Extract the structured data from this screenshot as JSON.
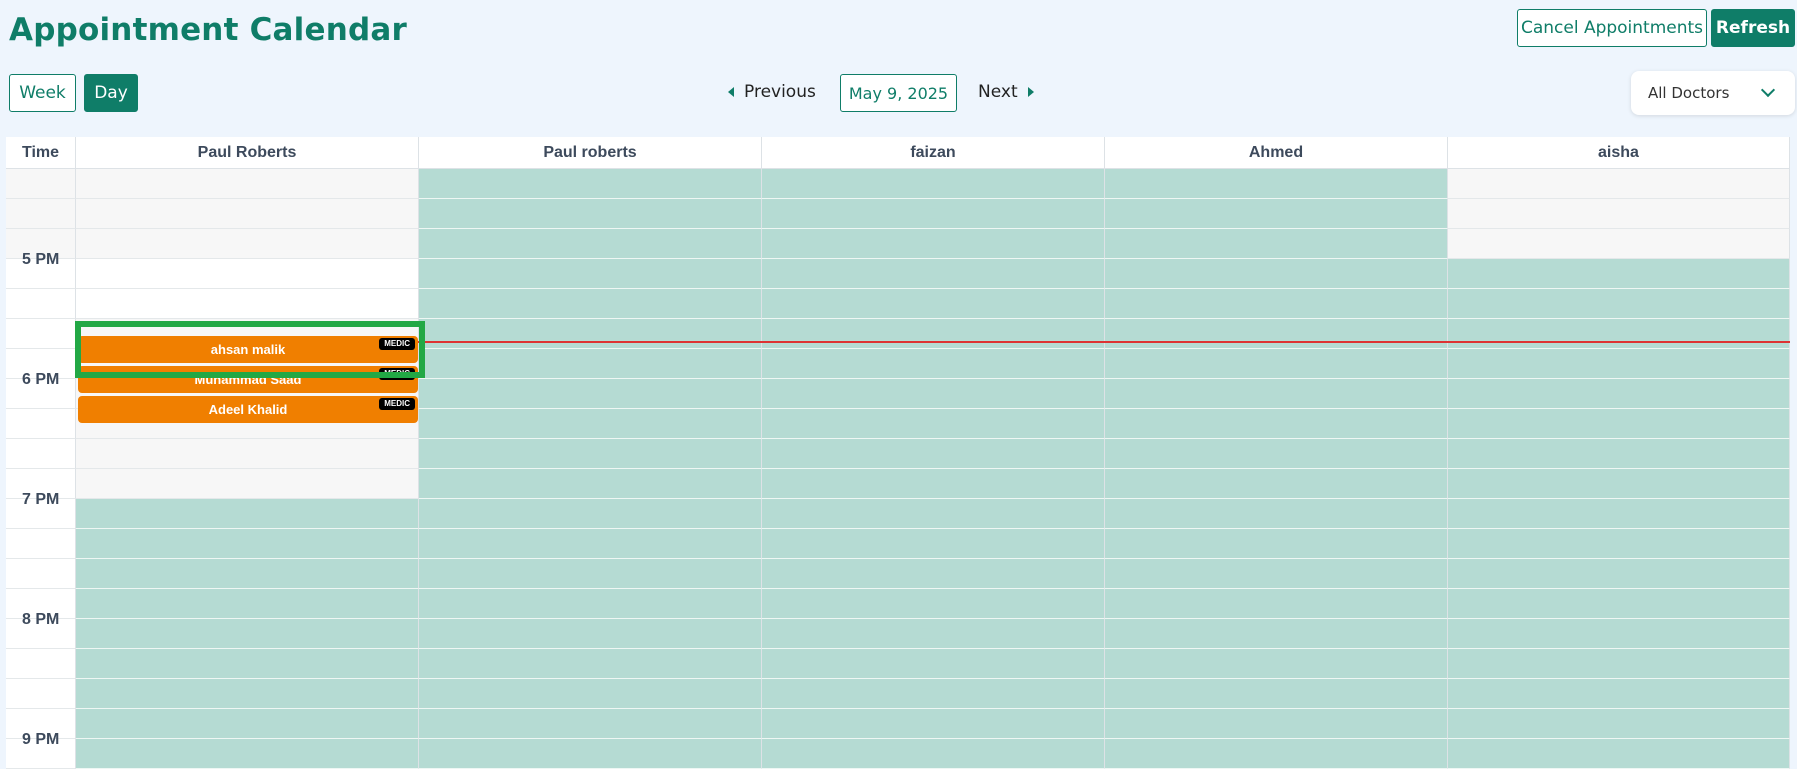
{
  "page": {
    "title": "Appointment Calendar"
  },
  "toolbar": {
    "cancel_label": "Cancel Appointments",
    "refresh_label": "Refresh",
    "week_label": "Week",
    "day_label": "Day",
    "previous_label": "Previous",
    "date_label": "May 9, 2025",
    "next_label": "Next",
    "doctor_filter": "All Doctors"
  },
  "calendar": {
    "time_header": "Time",
    "columns": [
      "Paul Roberts",
      "Paul roberts",
      "faizan",
      "Ahmed",
      "aisha"
    ],
    "time_labels": [
      "5 PM",
      "6 PM",
      "7 PM",
      "8 PM",
      "9 PM"
    ],
    "appointments": [
      {
        "name": "ahsan malik",
        "badge": "MEDIC"
      },
      {
        "name": "Muhammad Saad",
        "badge": "MEDIC"
      },
      {
        "name": "Adeel Khalid",
        "badge": "MEDIC"
      }
    ]
  },
  "colors": {
    "accent": "#0f7d68",
    "available": "#b5dbd3",
    "appointment": "#f07f00",
    "now_line": "#dd3333",
    "highlight": "#22a845"
  }
}
